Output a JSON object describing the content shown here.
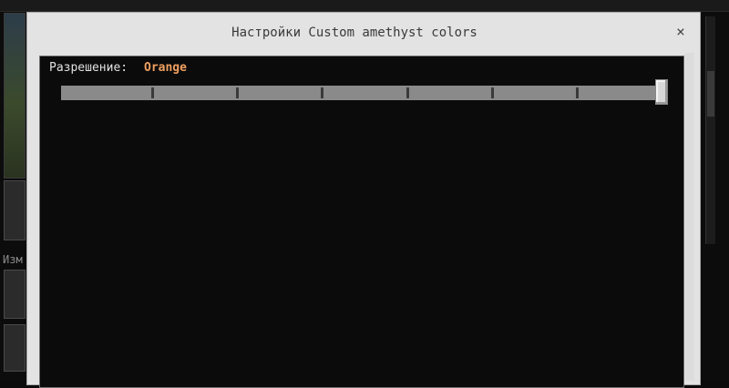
{
  "background": {
    "side_label": "Изм"
  },
  "dialog": {
    "title": "Настройки Custom amethyst colors",
    "close_glyph": "×",
    "close_icon": "close-icon",
    "setting": {
      "label": "Разрешение:",
      "value": "Orange",
      "value_color": "#f0a060",
      "slider": {
        "steps": 7,
        "position_fraction": 1.0
      }
    }
  }
}
